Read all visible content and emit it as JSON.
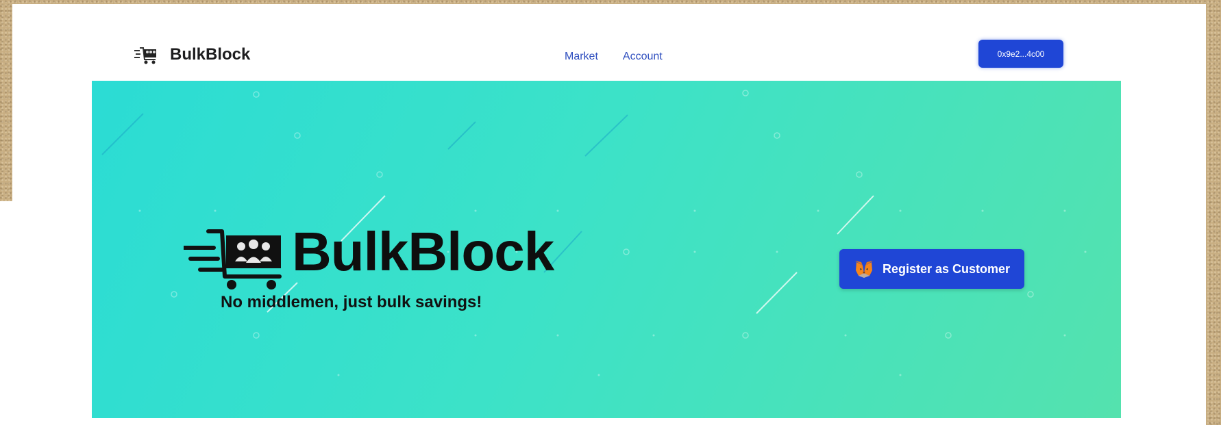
{
  "navbar": {
    "brand_name": "BulkBlock",
    "brand_logo_icon": "bulk-cart-icon",
    "links": [
      {
        "label": "Market"
      },
      {
        "label": "Account"
      }
    ],
    "wallet_address": "0x9e2...4c00"
  },
  "hero": {
    "title": "BulkBlock",
    "logo_icon": "bulk-cart-icon",
    "tagline": "No middlemen, just bulk savings!",
    "register_button": {
      "label": "Register as Customer",
      "icon": "metamask-fox-icon"
    }
  },
  "colors": {
    "accent": "#1f46d6",
    "nav_link": "#2f4fbf",
    "hero_gradient_start": "#2bdcd4",
    "hero_gradient_end": "#54e2ae"
  }
}
